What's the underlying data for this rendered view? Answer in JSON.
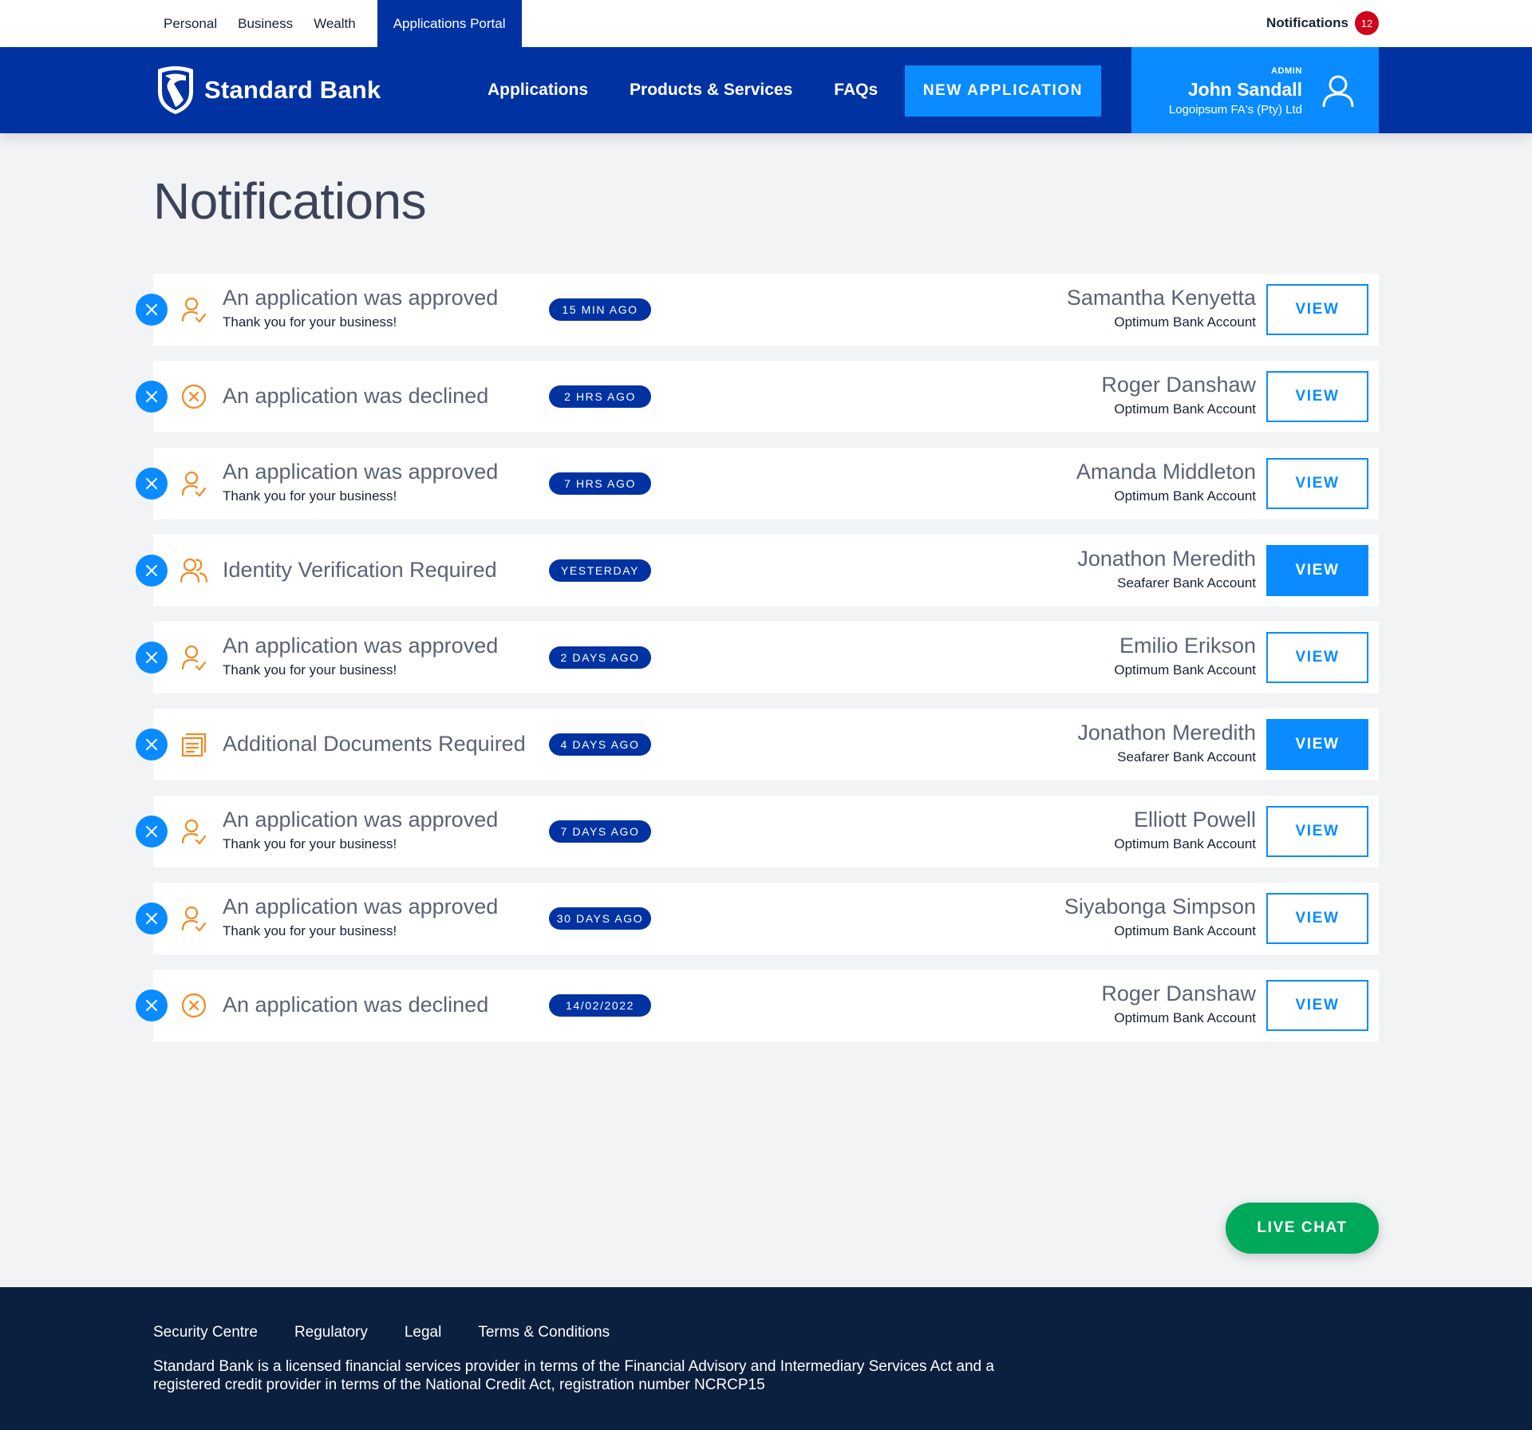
{
  "topbar": {
    "links": [
      "Personal",
      "Business",
      "Wealth",
      "Applications Portal"
    ],
    "notifications_label": "Notifications",
    "notifications_count": "12"
  },
  "header": {
    "brand": "Standard Bank",
    "nav": [
      "Applications",
      "Products & Services",
      "FAQs"
    ],
    "new_application": "NEW APPLICATION",
    "user": {
      "role": "ADMIN",
      "name": "John Sandall",
      "company": "Logoipsum FA's (Pty) Ltd"
    }
  },
  "page": {
    "title": "Notifications"
  },
  "notifications": [
    {
      "type": "approved",
      "icon": "user-check-icon",
      "title": "An application was approved",
      "subtitle": "Thank you for your business!",
      "time": "15 MIN AGO",
      "name": "Samantha Kenyetta",
      "account": "Optimum Bank Account",
      "view": "VIEW",
      "view_style": "outline"
    },
    {
      "type": "declined",
      "icon": "circle-x-icon",
      "title": "An application was declined",
      "subtitle": "",
      "time": "2 HRS AGO",
      "name": "Roger Danshaw",
      "account": "Optimum Bank Account",
      "view": "VIEW",
      "view_style": "outline"
    },
    {
      "type": "approved",
      "icon": "user-check-icon",
      "title": "An application was approved",
      "subtitle": "Thank you for your business!",
      "time": "7 HRS AGO",
      "name": "Amanda Middleton",
      "account": "Optimum Bank Account",
      "view": "VIEW",
      "view_style": "outline"
    },
    {
      "type": "identity",
      "icon": "users-icon",
      "title": "Identity Verification Required",
      "subtitle": "",
      "time": "YESTERDAY",
      "name": "Jonathon Meredith",
      "account": "Seafarer Bank Account",
      "view": "VIEW",
      "view_style": "solid"
    },
    {
      "type": "approved",
      "icon": "user-check-icon",
      "title": "An application was approved",
      "subtitle": "Thank you for your business!",
      "time": "2 DAYS AGO",
      "name": "Emilio Erikson",
      "account": "Optimum Bank Account",
      "view": "VIEW",
      "view_style": "outline"
    },
    {
      "type": "documents",
      "icon": "documents-icon",
      "title": "Additional Documents Required",
      "subtitle": "",
      "time": "4 DAYS AGO",
      "name": "Jonathon Meredith",
      "account": "Seafarer Bank Account",
      "view": "VIEW",
      "view_style": "solid"
    },
    {
      "type": "approved",
      "icon": "user-check-icon",
      "title": "An application was approved",
      "subtitle": "Thank you for your business!",
      "time": "7 DAYS AGO",
      "name": "Elliott Powell",
      "account": "Optimum Bank Account",
      "view": "VIEW",
      "view_style": "outline"
    },
    {
      "type": "approved",
      "icon": "user-check-icon",
      "title": "An application was approved",
      "subtitle": "Thank you for your business!",
      "time": "30 DAYS AGO",
      "name": "Siyabonga Simpson",
      "account": "Optimum Bank Account",
      "view": "VIEW",
      "view_style": "outline"
    },
    {
      "type": "declined",
      "icon": "circle-x-icon",
      "title": "An application was declined",
      "subtitle": "",
      "time": "14/02/2022",
      "name": "Roger Danshaw",
      "account": "Optimum Bank Account",
      "view": "VIEW",
      "view_style": "outline"
    }
  ],
  "live_chat": "LIVE CHAT",
  "footer": {
    "links": [
      "Security Centre",
      "Regulatory",
      "Legal",
      "Terms & Conditions"
    ],
    "copy": "Standard Bank is a licensed financial services provider in terms of the Financial Advisory and Intermediary Services Act and a registered credit provider in terms of the National Credit Act, registration number NCRCP15"
  },
  "colors": {
    "primary": "#0033a1",
    "accent": "#0a8bff",
    "icon_orange": "#f08a24",
    "badge_red": "#d0021b",
    "live_chat": "#00a85a",
    "footer": "#0b1f3e"
  }
}
